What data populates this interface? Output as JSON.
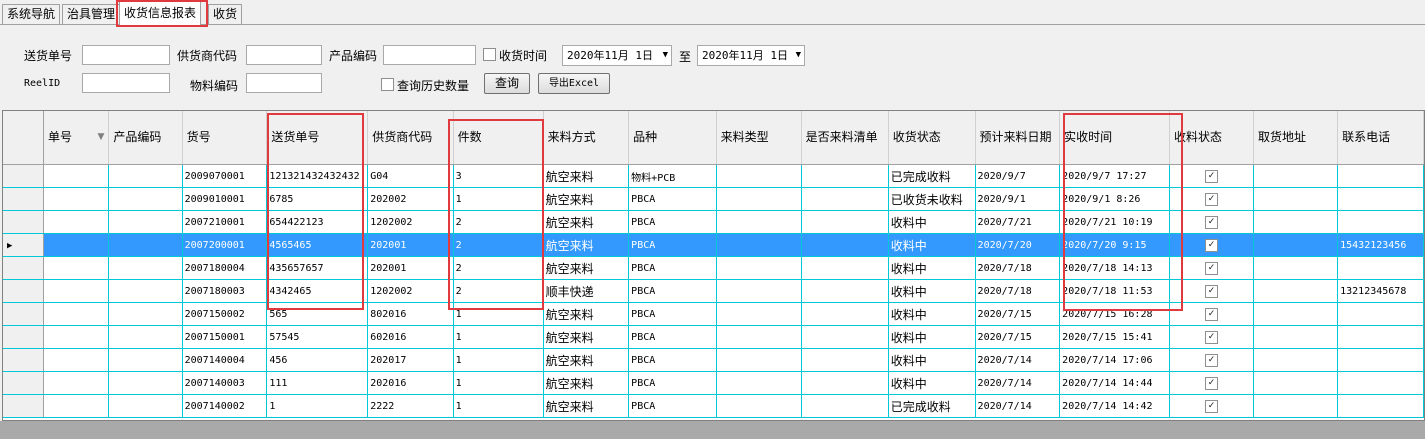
{
  "tabs": [
    "系统导航",
    "治具管理",
    "收货信息报表",
    "收货"
  ],
  "filters": {
    "delivery_no_label": "送货单号",
    "supplier_code_label": "供货商代码",
    "product_code_label": "产品编码",
    "receive_time_label": "收货时间",
    "date_from": "2020年11月 1日",
    "to_label": "至",
    "date_to": "2020年11月 1日",
    "reel_id_label": "ReelID",
    "material_code_label": "物料编码",
    "history_label": "查询历史数量",
    "query_button": "查询",
    "export_button": "导出Excel"
  },
  "table": {
    "headers": [
      "单号",
      "产品编码",
      "货号",
      "送货单号",
      "供货商代码",
      "件数",
      "来料方式",
      "品种",
      "来料类型",
      "是否来料清单",
      "收货状态",
      "预计来料日期",
      "实收时间",
      "收料状态",
      "取货地址",
      "联系电话"
    ],
    "rows": [
      [
        "",
        "",
        "2009070001",
        "121321432432432",
        "G04",
        "3",
        "航空来料",
        "物料+PCB",
        "",
        "",
        "已完成收料",
        "2020/9/7",
        "2020/9/7 17:27",
        "",
        "",
        ""
      ],
      [
        "",
        "",
        "2009010001",
        "6785",
        "202002",
        "1",
        "航空来料",
        "PBCA",
        "",
        "",
        "已收货未收料",
        "2020/9/1",
        "2020/9/1 8:26",
        "",
        "",
        ""
      ],
      [
        "",
        "",
        "2007210001",
        "654422123",
        "1202002",
        "2",
        "航空来料",
        "PBCA",
        "",
        "",
        "收料中",
        "2020/7/21",
        "2020/7/21 10:19",
        "",
        "",
        ""
      ],
      [
        "",
        "",
        "2007200001",
        "4565465",
        "202001",
        "2",
        "航空来料",
        "PBCA",
        "",
        "",
        "收料中",
        "2020/7/20",
        "2020/7/20 9:15",
        "",
        "",
        "15432123456"
      ],
      [
        "",
        "",
        "2007180004",
        "435657657",
        "202001",
        "2",
        "航空来料",
        "PBCA",
        "",
        "",
        "收料中",
        "2020/7/18",
        "2020/7/18 14:13",
        "",
        "",
        ""
      ],
      [
        "",
        "",
        "2007180003",
        "4342465",
        "1202002",
        "2",
        "顺丰快递",
        "PBCA",
        "",
        "",
        "收料中",
        "2020/7/18",
        "2020/7/18 11:53",
        "",
        "",
        "13212345678"
      ],
      [
        "",
        "",
        "2007150002",
        "565",
        "802016",
        "1",
        "航空来料",
        "PBCA",
        "",
        "",
        "收料中",
        "2020/7/15",
        "2020/7/15 16:28",
        "",
        "",
        ""
      ],
      [
        "",
        "",
        "2007150001",
        "57545",
        "602016",
        "1",
        "航空来料",
        "PBCA",
        "",
        "",
        "收料中",
        "2020/7/15",
        "2020/7/15 15:41",
        "",
        "",
        ""
      ],
      [
        "",
        "",
        "2007140004",
        "456",
        "202017",
        "1",
        "航空来料",
        "PBCA",
        "",
        "",
        "收料中",
        "2020/7/14",
        "2020/7/14 17:06",
        "",
        "",
        ""
      ],
      [
        "",
        "",
        "2007140003",
        "111",
        "202016",
        "1",
        "航空来料",
        "PBCA",
        "",
        "",
        "收料中",
        "2020/7/14",
        "2020/7/14 14:44",
        "",
        "",
        ""
      ],
      [
        "",
        "",
        "2007140002",
        "1",
        "2222",
        "1",
        "航空来料",
        "PBCA",
        "",
        "",
        "已完成收料",
        "2020/7/14",
        "2020/7/14 14:42",
        "",
        "",
        ""
      ]
    ],
    "selected_row": 3,
    "checked_mark": "✓"
  }
}
